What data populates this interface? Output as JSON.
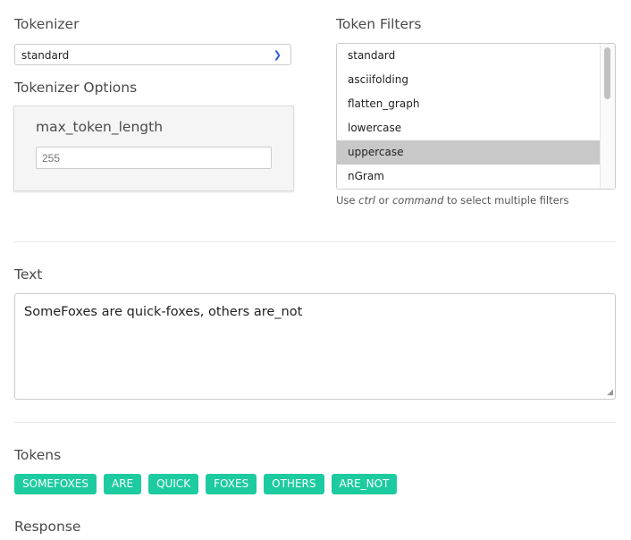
{
  "tokenizer": {
    "label": "Tokenizer",
    "selected": "standard"
  },
  "tokenizer_options": {
    "label": "Tokenizer Options",
    "field_label": "max_token_length",
    "field_placeholder": "255"
  },
  "token_filters": {
    "label": "Token Filters",
    "items": [
      "standard",
      "asciifolding",
      "flatten_graph",
      "lowercase",
      "uppercase",
      "nGram"
    ],
    "selected": "uppercase",
    "hint": {
      "pre": "Use ",
      "k1": "ctrl",
      "mid": " or ",
      "k2": "command",
      "post": " to select multiple filters"
    }
  },
  "text": {
    "label": "Text",
    "value": "SomeFoxes are quick-foxes, others are_not"
  },
  "tokens": {
    "label": "Tokens",
    "items": [
      "SOMEFOXES",
      "ARE",
      "QUICK",
      "FOXES",
      "OTHERS",
      "ARE_NOT"
    ],
    "color": "#1dcba0"
  },
  "response": {
    "label": "Response"
  }
}
